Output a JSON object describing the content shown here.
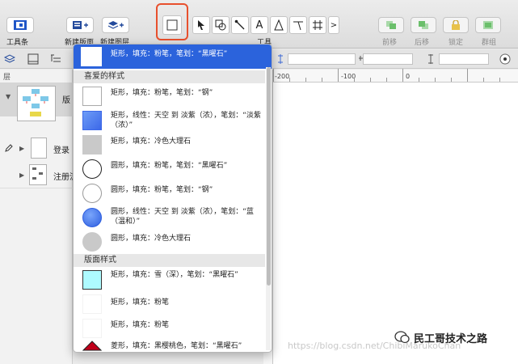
{
  "toolbar": {
    "toolbar_label": "工具条",
    "new_canvas_label": "新建版面",
    "new_layer_label": "新建图层",
    "tools_label": "工具",
    "forward_label": "前移",
    "backward_label": "后移",
    "lock_label": "锁定",
    "group_label": "群组",
    "text_tool_glyph": "A",
    "more_glyph": ">"
  },
  "left_panel": {
    "layers_header": "层",
    "canvas_name": "版",
    "rows": [
      {
        "label": "登录"
      },
      {
        "label": "注册流"
      }
    ]
  },
  "ruler": {
    "labels": [
      "-200",
      "-100",
      "0"
    ]
  },
  "style_menu": {
    "selected": "矩形，填充：粉笔，笔划：“黑曜石”",
    "favorites_header": "喜爱的样式",
    "favorites": [
      {
        "text": "矩形，填充：粉笔，笔划：“钢”",
        "shape": "rect",
        "fill": "#ffffff"
      },
      {
        "text": "矩形，线性：天空 到 淡紫（浓），笔划：“淡紫（浓）”",
        "shape": "rect",
        "fill": "#4b7ff0"
      },
      {
        "text": "矩形，填充：冷色大理石",
        "shape": "rect",
        "fill": "#c9c9c9"
      },
      {
        "text": "圆形，填充：粉笔，笔划：“黑曜石”",
        "shape": "circle",
        "fill": "#ffffff"
      },
      {
        "text": "圆形，填充：粉笔，笔划：“钢”",
        "shape": "circle",
        "fill": "#ffffff"
      },
      {
        "text": "圆形，线性：天空 到 淡紫（浓），笔划：“蓝（温和）”",
        "shape": "circle",
        "fill": "#4b7ff0"
      },
      {
        "text": "圆形，填充：冷色大理石",
        "shape": "circle",
        "fill": "#c9c9c9"
      }
    ],
    "canvas_header": "版面样式",
    "canvas_styles": [
      {
        "text": "矩形，填充：雪（深），笔划：“黑曜石”",
        "shape": "rect",
        "fill": "#aefbff"
      },
      {
        "text": "矩形，填充：粉笔",
        "shape": "rect",
        "fill": "#ffffff"
      },
      {
        "text": "矩形，填充：粉笔",
        "shape": "rect",
        "fill": "#ffffff"
      },
      {
        "text": "菱形，填充：黑樱桃色，笔划：“黑曜石”",
        "shape": "diamond",
        "fill": "#c0001a"
      }
    ]
  },
  "watermark": "https://blog.csdn.net/ChibiMarukoChan",
  "wechat_caption": "民工哥技术之路"
}
